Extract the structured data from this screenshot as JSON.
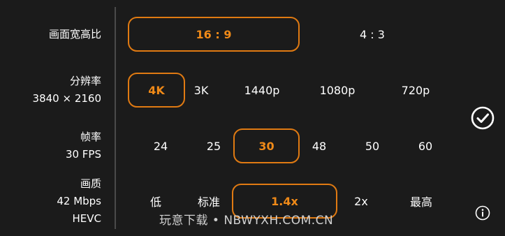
{
  "accent_color": "#e07a12",
  "aspect_ratio": {
    "label": "画面宽高比",
    "options": [
      "16 : 9",
      "4 : 3"
    ],
    "selected": "16 : 9"
  },
  "resolution": {
    "label": "分辨率",
    "sublabel": "3840 × 2160",
    "options": [
      "4K",
      "3K",
      "1440p",
      "1080p",
      "720p"
    ],
    "selected": "4K"
  },
  "frame_rate": {
    "label": "帧率",
    "sublabel": "30 FPS",
    "options": [
      "24",
      "25",
      "30",
      "48",
      "50",
      "60"
    ],
    "selected": "30"
  },
  "quality": {
    "label": "画质",
    "sublabel": "42 Mbps",
    "sublabel2": "HEVC",
    "options": [
      "低",
      "标准",
      "1.4x",
      "2x",
      "最高"
    ],
    "selected": "1.4x"
  },
  "confirm_icon": "check-circle-icon",
  "info_icon": "info-circle-icon",
  "watermark": "玩意下载 • NBWYXH.COM.CN"
}
